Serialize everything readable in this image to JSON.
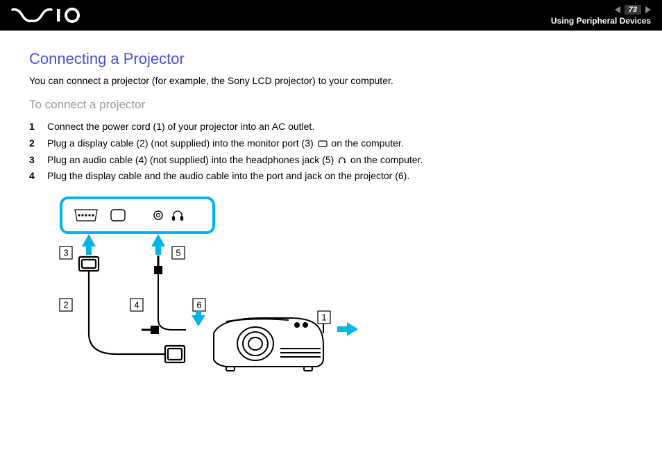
{
  "header": {
    "page_number": "73",
    "section": "Using Peripheral Devices"
  },
  "content": {
    "title": "Connecting a Projector",
    "intro": "You can connect a projector (for example, the Sony LCD projector) to your computer.",
    "subtitle": "To connect a projector",
    "steps": [
      {
        "n": "1",
        "text_a": "Connect the power cord (1) of your projector into an AC outlet."
      },
      {
        "n": "2",
        "text_a": "Plug a display cable (2) (not supplied) into the monitor port (3) ",
        "text_b": " on the computer."
      },
      {
        "n": "3",
        "text_a": "Plug an audio cable (4) (not supplied) into the headphones jack (5) ",
        "text_b": " on the computer."
      },
      {
        "n": "4",
        "text_a": "Plug the display cable and the audio cable into the port and jack on the projector (6)."
      }
    ],
    "callouts": {
      "c1": "1",
      "c2": "2",
      "c3": "3",
      "c4": "4",
      "c5": "5",
      "c6": "6"
    }
  }
}
